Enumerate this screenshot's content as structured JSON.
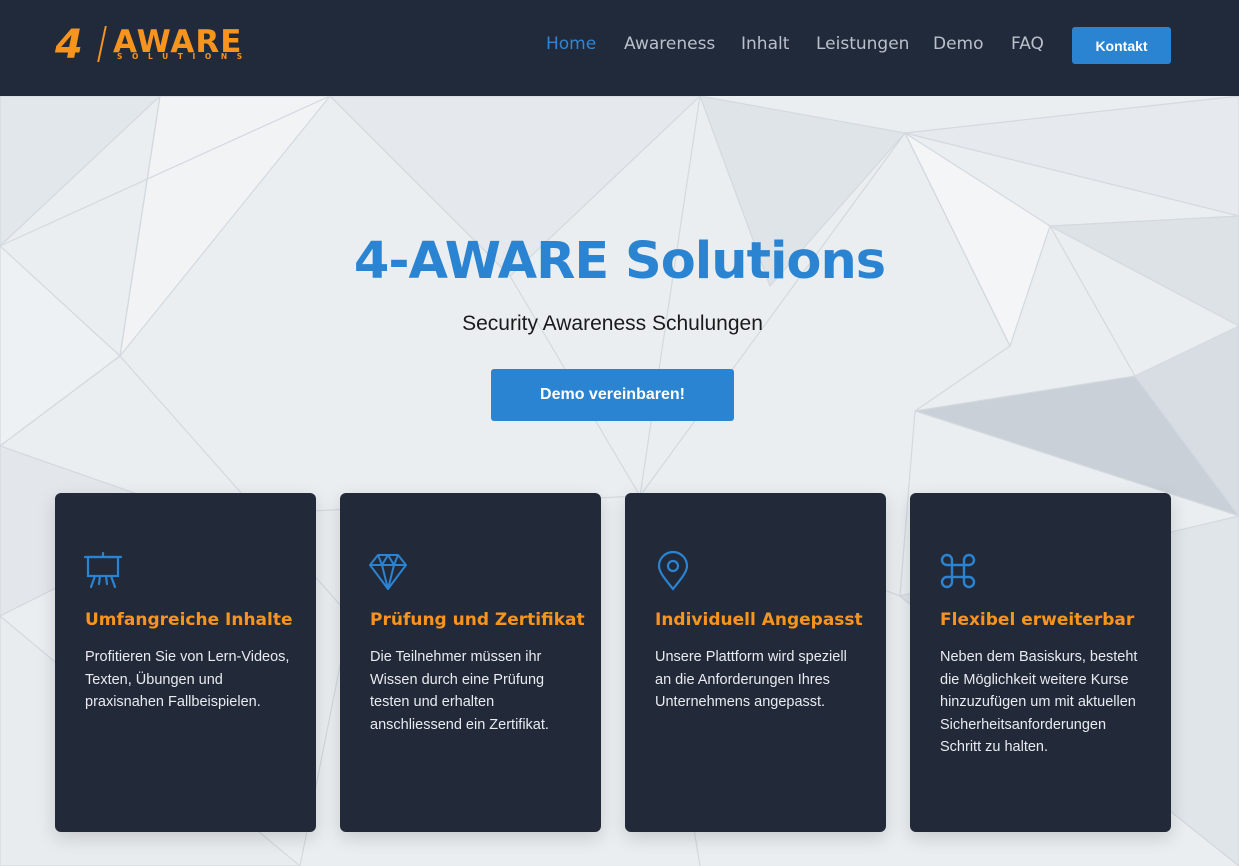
{
  "brand": {
    "logo_four": "4",
    "logo_name": "AWARE",
    "logo_sub": "SOLUTIONS",
    "accent": "#f7941d",
    "primary": "#2a84d2",
    "dark": "#212a3a"
  },
  "nav": {
    "items": [
      {
        "label": "Home",
        "active": true
      },
      {
        "label": "Awareness",
        "active": false
      },
      {
        "label": "Inhalt",
        "active": false
      },
      {
        "label": "Leistungen",
        "active": false
      },
      {
        "label": "Demo",
        "active": false
      },
      {
        "label": "FAQ",
        "active": false
      }
    ],
    "contact_label": "Kontakt"
  },
  "hero": {
    "title": "4-AWARE Solutions",
    "subtitle": "Security Awareness Schulungen",
    "cta_label": "Demo vereinbaren!"
  },
  "features": [
    {
      "icon": "presentation-easel-icon",
      "title": "Umfangreiche Inhalte",
      "text": "Profitieren Sie von Lern-Videos, Texten, Übungen und praxisnahen Fallbeispielen."
    },
    {
      "icon": "diamond-icon",
      "title": "Prüfung und Zertifikat",
      "text": "Die Teilnehmer müssen ihr Wissen durch eine Prüfung testen und erhalten anschliessend ein Zertifikat."
    },
    {
      "icon": "map-pin-icon",
      "title": "Individuell Angepasst",
      "text": "Unsere Plattform wird speziell an die Anforderungen Ihres Unternehmens angepasst."
    },
    {
      "icon": "command-icon",
      "title": "Flexibel erweiterbar",
      "text": "Neben dem Basiskurs, besteht die Möglichkeit weitere Kurse hinzuzufügen um mit aktuellen Sicherheitsanforderungen Schritt zu halten."
    }
  ]
}
